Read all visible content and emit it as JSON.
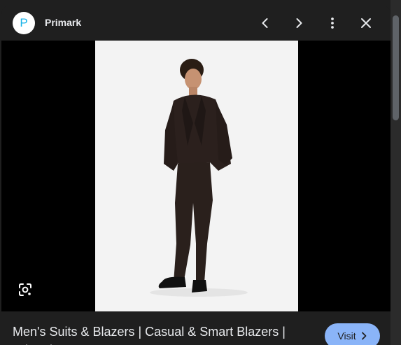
{
  "header": {
    "avatar_letter": "P",
    "site_name": "Primark"
  },
  "icons": {
    "prev": "chevron-left-icon",
    "next": "chevron-right-icon",
    "more": "more-vert-icon",
    "close": "close-icon",
    "lens": "google-lens-icon"
  },
  "caption": {
    "title": "Men's Suits & Blazers | Casual & Smart Blazers | Primark"
  },
  "visit_button": {
    "label": "Visit"
  },
  "colors": {
    "background": "#1f1f1f",
    "accent": "#8ab4f8",
    "avatar_letter": "#19b3e8"
  }
}
